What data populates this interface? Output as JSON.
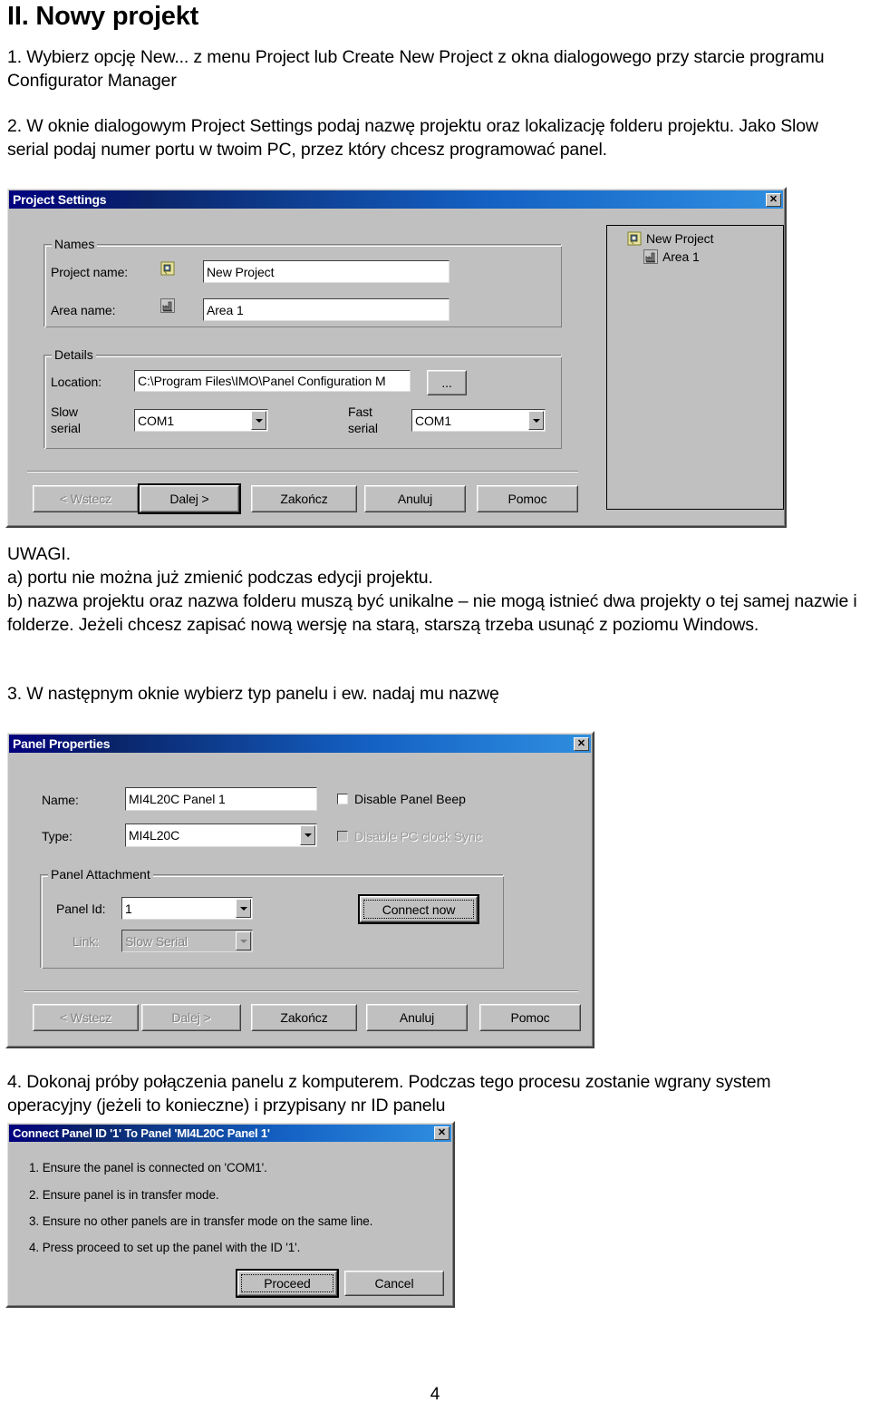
{
  "document": {
    "title": "II. Nowy projekt",
    "step1": "1. Wybierz opcję New... z menu Project lub Create New Project z okna dialogowego przy starcie programu Configurator Manager",
    "step2": "2. W oknie dialogowym Project Settings podaj nazwę projektu oraz lokalizację folderu projektu. Jako Slow serial podaj numer portu w twoim PC, przez który chcesz programować panel.",
    "notes": "UWAGI.\na) portu nie można już zmienić podczas edycji projektu.\nb) nazwa projektu oraz nazwa folderu muszą być unikalne – nie mogą istnieć dwa projekty o tej samej nazwie i folderze. Jeżeli chcesz zapisać nową wersję na starą, starszą trzeba usunąć z poziomu Windows.",
    "step3": "3. W następnym oknie wybierz typ panelu i ew. nadaj mu nazwę",
    "step4": "4. Dokonaj próby połączenia panelu z komputerem. Podczas tego procesu zostanie wgrany system operacyjny (jeżeli to konieczne) i przypisany nr ID panelu",
    "page_number": "4"
  },
  "project_settings_dialog": {
    "title": "Project Settings",
    "close_label": "✕",
    "names_group": {
      "legend": "Names",
      "project_name_label": "Project name:",
      "project_name_value": "New Project",
      "project_name_icon": "project-note-icon",
      "area_name_label": "Area name:",
      "area_name_value": "Area 1",
      "area_name_icon": "factory-icon"
    },
    "details_group": {
      "legend": "Details",
      "location_label": "Location:",
      "location_value": "C:\\Program Files\\IMO\\Panel Configuration M",
      "browse_label": "...",
      "slow_serial_label_line1": "Slow",
      "slow_serial_label_line2": "serial",
      "slow_serial_value": "COM1",
      "fast_serial_label_line1": "Fast",
      "fast_serial_label_line2": "serial",
      "fast_serial_value": "COM1"
    },
    "tree": {
      "root_label": "New Project",
      "root_icon": "project-note-icon",
      "child_label": "Area 1",
      "child_icon": "factory-icon"
    },
    "buttons": {
      "back": "< Wstecz",
      "back_mnemonic": "W",
      "next": "Dalej >",
      "next_mnemonic": "D",
      "finish": "Zakończ",
      "cancel": "Anuluj",
      "help": "Pomoc"
    }
  },
  "panel_properties_dialog": {
    "title": "Panel Properties",
    "close_label": "✕",
    "name_label": "Name:",
    "name_value": "MI4L20C Panel 1",
    "type_label": "Type:",
    "type_value": "MI4L20C",
    "disable_panel_beep_label": "Disable Panel Beep",
    "disable_pc_clock_sync_label": "Disable PC clock Sync",
    "attachment_group": {
      "legend": "Panel Attachment",
      "panel_id_label": "Panel Id:",
      "panel_id_value": "1",
      "link_label": "Link:",
      "link_value": "Slow Serial",
      "connect_now_label": "Connect now"
    },
    "buttons": {
      "back": "< Wstecz",
      "back_mnemonic": "W",
      "next": "Dalej >",
      "next_mnemonic": "D",
      "finish": "Zakończ",
      "cancel": "Anuluj",
      "help": "Pomoc"
    }
  },
  "connect_panel_dialog": {
    "title": "Connect Panel ID '1' To Panel 'MI4L20C Panel 1'",
    "close_label": "✕",
    "lines": [
      "1. Ensure the panel is connected on 'COM1'.",
      "2. Ensure panel is in transfer mode.",
      "3. Ensure no other panels are in transfer mode on the same line.",
      "4. Press proceed to set up the panel with the ID '1'."
    ],
    "proceed_label": "Proceed",
    "cancel_label": "Cancel"
  },
  "colors": {
    "face": "#c0c0c0",
    "title_start": "#00007e",
    "title_end": "#2f8fe0",
    "field_bg": "#ffffff",
    "disabled_text": "#808080"
  }
}
